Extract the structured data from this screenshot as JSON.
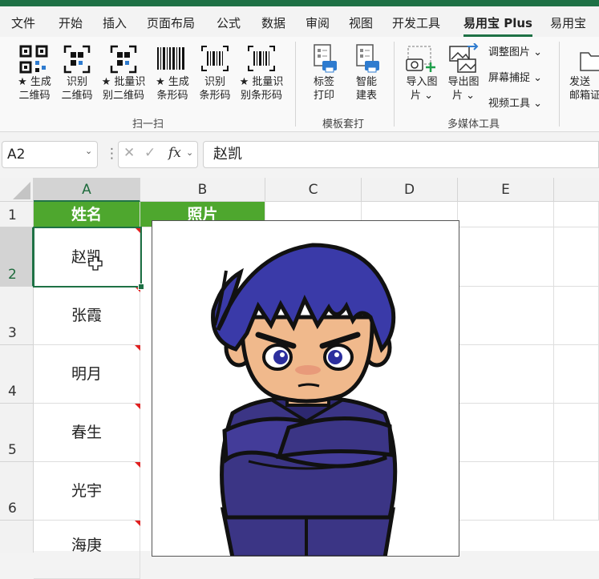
{
  "tabs": [
    "文件",
    "开始",
    "插入",
    "页面布局",
    "公式",
    "数据",
    "审阅",
    "视图",
    "开发工具",
    "易用宝 Plus",
    "易用宝"
  ],
  "ribbon": {
    "group1": {
      "label": "扫一扫",
      "buttons": [
        "★ 生成\n二维码",
        "识别\n二维码",
        "★ 批量识\n别二维码",
        "★ 生成\n条形码",
        "识别\n条形码",
        "★ 批量识\n别条形码"
      ]
    },
    "group2": {
      "label": "模板套打",
      "buttons": [
        "标签\n打印",
        "智能\n建表"
      ]
    },
    "group3": {
      "label": "多媒体工具",
      "buttons": [
        "导入图\n片 ⌄",
        "导出图\n片 ⌄"
      ],
      "small": [
        "调整图片 ⌄",
        "屏幕捕捉 ⌄",
        "视频工具 ⌄"
      ]
    },
    "group4": {
      "buttons": [
        "发送\n邮箱证"
      ]
    }
  },
  "formula_bar": {
    "name_box": "A2",
    "fx": "fx",
    "content": "赵凯"
  },
  "columns": [
    "A",
    "B",
    "C",
    "D",
    "E"
  ],
  "rows": [
    "1",
    "2",
    "3",
    "4",
    "5",
    "6"
  ],
  "table": {
    "header": [
      "姓名",
      "照片"
    ],
    "names": [
      "赵凯",
      "张霞",
      "明月",
      "春生",
      "光宇",
      "海庚"
    ]
  },
  "colors": {
    "excel_green": "#1e7145",
    "header_fill": "#4ea72e",
    "comment_red": "#e02020",
    "hair": "#3a3aa8",
    "jacket": "#3b3585"
  }
}
